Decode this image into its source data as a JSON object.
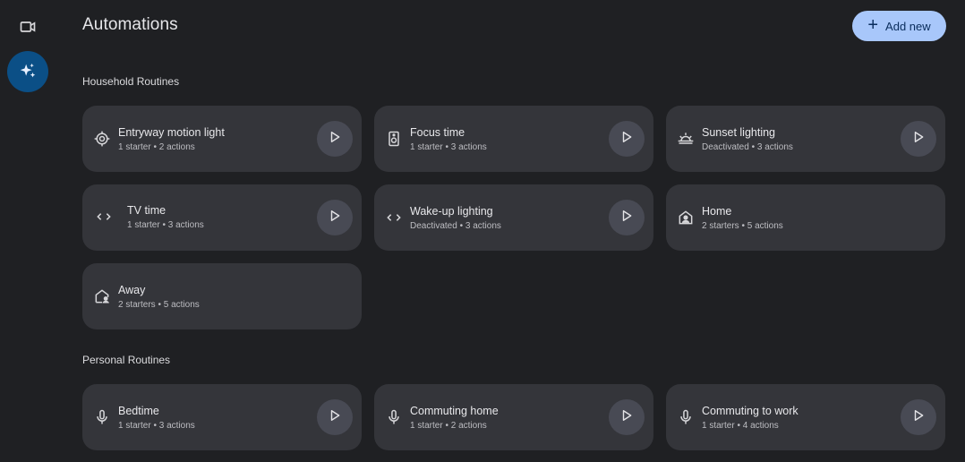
{
  "header": {
    "title": "Automations",
    "add_button_label": "Add new"
  },
  "rail": {
    "items": [
      {
        "icon": "video-camera-icon",
        "active": false
      },
      {
        "icon": "sparkle-icon",
        "active": true
      }
    ]
  },
  "sections": [
    {
      "title": "Household Routines",
      "routines": [
        {
          "name": "Entryway motion light",
          "subtitle": "1 starter • 2 actions",
          "icon": "motion-sensor-icon",
          "playable": true
        },
        {
          "name": "Focus time",
          "subtitle": "1 starter • 3 actions",
          "icon": "speaker-icon",
          "playable": true
        },
        {
          "name": "Sunset lighting",
          "subtitle": "Deactivated • 3 actions",
          "icon": "sunset-icon",
          "playable": true
        },
        {
          "name": "TV time",
          "subtitle": "1 starter • 3 actions",
          "icon": "code-brackets-icon",
          "playable": true
        },
        {
          "name": "Wake-up lighting",
          "subtitle": "Deactivated • 3 actions",
          "icon": "code-brackets-icon",
          "playable": true
        },
        {
          "name": "Home",
          "subtitle": "2 starters • 5 actions",
          "icon": "home-person-icon",
          "playable": false
        },
        {
          "name": "Away",
          "subtitle": "2 starters • 5 actions",
          "icon": "away-home-icon",
          "playable": false
        }
      ]
    },
    {
      "title": "Personal Routines",
      "routines": [
        {
          "name": "Bedtime",
          "subtitle": "1 starter • 3 actions",
          "icon": "microphone-icon",
          "playable": true
        },
        {
          "name": "Commuting home",
          "subtitle": "1 starter • 2 actions",
          "icon": "microphone-icon",
          "playable": true
        },
        {
          "name": "Commuting to work",
          "subtitle": "1 starter • 4 actions",
          "icon": "microphone-icon",
          "playable": true
        }
      ]
    }
  ],
  "colors": {
    "background": "#1f2023",
    "card": "#34353a",
    "play_button": "#484a54",
    "accent_button": "#a8c7fa",
    "rail_active": "#0b4f86"
  }
}
